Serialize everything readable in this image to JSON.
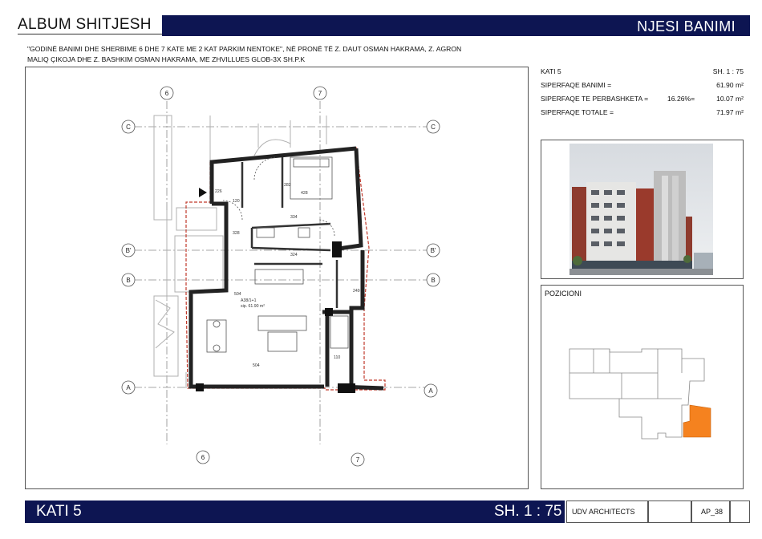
{
  "header": {
    "album_title": "ALBUM SHITJESH",
    "unit_title": "NJESI BANIMI"
  },
  "description": {
    "line1": "\"GODINË BANIMI DHE SHERBIME 6 DHE 7 KATE ME 2 KAT PARKIM NENTOKE\", NË PRONË TË  Z. DAUT OSMAN HAKRAMA, Z. AGRON",
    "line2": "MALIQ ÇIKOJA DHE Z. BASHKIM OSMAN HAKRAMA,  ME  ZHVILLUES GLOB-3X SH.P.K"
  },
  "info": {
    "floor": "KATI 5",
    "scale": "SH. 1 : 75",
    "residential_label": "SIPERFAQE BANIMI =",
    "residential_value": "61.90 m²",
    "common_label": "SIPERFAQE TE PERBASHKETA =",
    "common_percent": "16.26%=",
    "common_value": "10.07 m²",
    "total_label": "SIPERFAQE TOTALE =",
    "total_value": "71.97 m²"
  },
  "position": {
    "title": "POZICIONI",
    "highlight_color": "#f5821f"
  },
  "plan": {
    "grid_rows": [
      "C",
      "B'",
      "B",
      "A"
    ],
    "grid_cols": [
      "6",
      "7"
    ],
    "room_labels": {
      "unit_id": "A38/1+1",
      "unit_area": "sip. 61.90 m²",
      "bedroom_width": "428",
      "corridor_width": "334",
      "kitchen_width": "324",
      "living_width_top": "504",
      "living_width_bottom": "504",
      "balcony_width": "110",
      "entry_dim": "120",
      "door_dim_1": "226",
      "door_dim_2": "249",
      "height_dim": "328",
      "wall_dim": "282",
      "stair_tag": "205\n226"
    }
  },
  "footer": {
    "floor": "KATI 5",
    "scale": "SH. 1 : 75",
    "architect": "UDV ARCHITECTS",
    "sheet": "AP_38"
  },
  "colors": {
    "navy": "#0d1552",
    "boundary_red": "#c0392b",
    "highlight_orange": "#f5821f"
  }
}
